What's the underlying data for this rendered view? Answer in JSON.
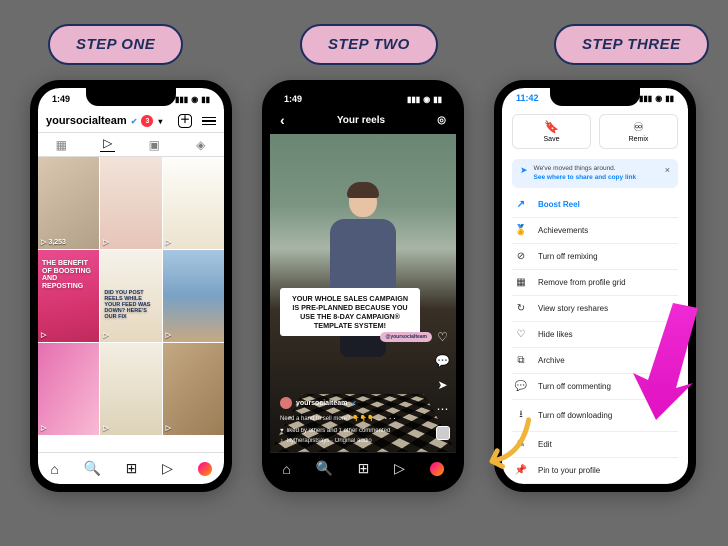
{
  "steps": {
    "one": "STEP ONE",
    "two": "STEP TWO",
    "three": "STEP THREE"
  },
  "status": {
    "time1": "1:49",
    "time2": "1:49",
    "time3": "11:42"
  },
  "profile": {
    "username": "yoursocialteam",
    "notif": "3",
    "cells": [
      {
        "count": "3,253"
      },
      {
        "count": ""
      },
      {
        "count": ""
      },
      {
        "count": "",
        "text": "THE BENEFIT OF BOOSTING AND REPOSTING"
      },
      {
        "count": "",
        "text": "DID YOU POST REELS WHILE YOUR FEED WAS DOWN? HERE'S OUR FIX"
      },
      {
        "count": ""
      },
      {
        "count": ""
      },
      {
        "count": ""
      },
      {
        "count": ""
      }
    ]
  },
  "reel": {
    "header": "Your reels",
    "caption": "YOUR WHOLE SALES CAMPAIGN IS PRE-PLANNED BECAUSE YOU USE THE 8-DAY CAMPAIGN® TEMPLATE SYSTEM!",
    "tag": "@yoursocialteam",
    "user": "yoursocialteam",
    "desc": "Need a hand to sell more? 👇👇👇 ...",
    "liked": "liked by others and 1 other commented",
    "audio": "lilytherapistsays · Original audio",
    "more": "···"
  },
  "sheet": {
    "save": "Save",
    "remix": "Remix",
    "tip_lead": "We've moved things around.",
    "tip_link": "See where to share and copy link",
    "options": [
      {
        "icon": "boost",
        "label": "Boost Reel"
      },
      {
        "icon": "achieve",
        "label": "Achievements"
      },
      {
        "icon": "remix",
        "label": "Turn off remixing"
      },
      {
        "icon": "grid",
        "label": "Remove from profile grid"
      },
      {
        "icon": "story",
        "label": "View story reshares"
      },
      {
        "icon": "hide",
        "label": "Hide likes"
      },
      {
        "icon": "archive",
        "label": "Archive"
      },
      {
        "icon": "comment",
        "label": "Turn off commenting"
      },
      {
        "icon": "download",
        "label": "Turn off downloading"
      },
      {
        "icon": "edit",
        "label": "Edit"
      },
      {
        "icon": "pin",
        "label": "Pin to your profile"
      }
    ]
  }
}
